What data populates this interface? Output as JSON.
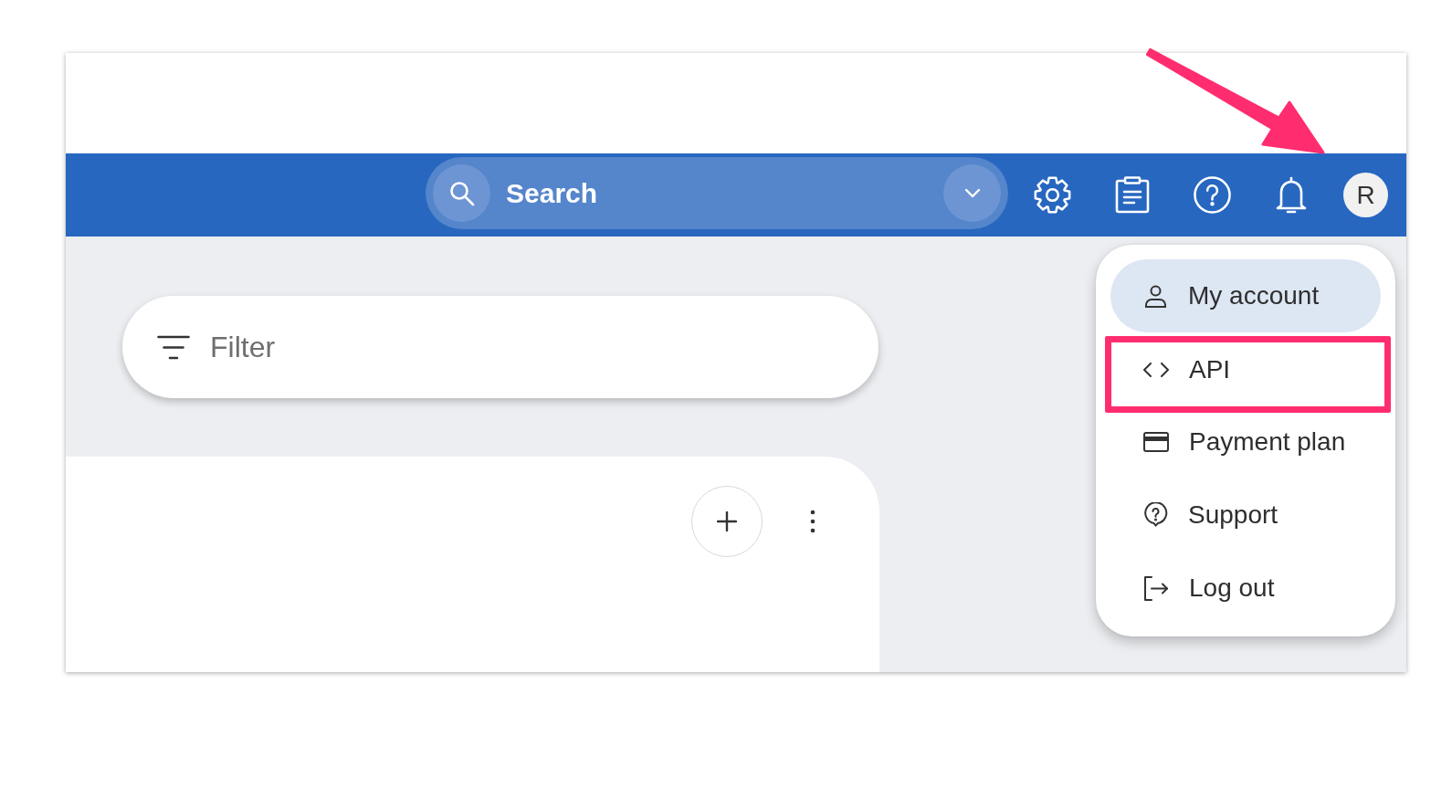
{
  "search": {
    "placeholder": "Search"
  },
  "avatar": {
    "initial": "R"
  },
  "filter": {
    "placeholder": "Filter"
  },
  "menu": {
    "items": [
      {
        "label": "My account",
        "selected": true,
        "highlighted": false
      },
      {
        "label": "API",
        "selected": false,
        "highlighted": true
      },
      {
        "label": "Payment plan",
        "selected": false,
        "highlighted": false
      },
      {
        "label": "Support",
        "selected": false,
        "highlighted": false
      },
      {
        "label": "Log out",
        "selected": false,
        "highlighted": false
      }
    ]
  }
}
